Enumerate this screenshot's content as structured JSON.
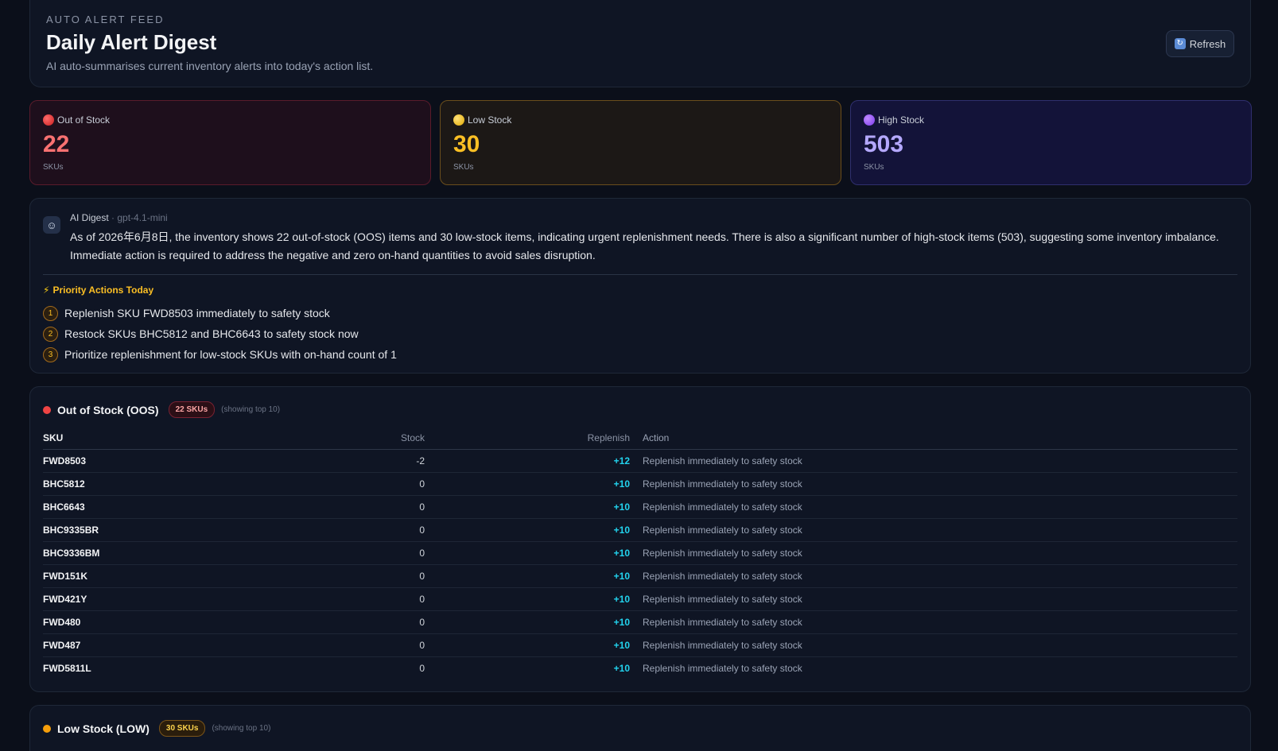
{
  "header": {
    "eyebrow": "AUTO ALERT FEED",
    "title": "Daily Alert Digest",
    "subtitle": "AI auto-summarises current inventory alerts into today's action list.",
    "refresh_label": "Refresh"
  },
  "stats": [
    {
      "label": "Out of Stock",
      "value": "22",
      "unit": "SKUs",
      "color": "#f87171"
    },
    {
      "label": "Low Stock",
      "value": "30",
      "unit": "SKUs",
      "color": "#fbbf24"
    },
    {
      "label": "High Stock",
      "value": "503",
      "unit": "SKUs",
      "color": "#b4a8ff"
    }
  ],
  "digest": {
    "label": "AI Digest",
    "model": "· gpt-4.1-mini",
    "text": "As of 2026年6月8日, the inventory shows 22 out-of-stock (OOS) items and 30 low-stock items, indicating urgent replenishment needs. There is also a significant number of high-stock items (503), suggesting some inventory imbalance. Immediate action is required to address the negative and zero on-hand quantities to avoid sales disruption.",
    "priority_title": "Priority Actions Today",
    "actions": [
      {
        "num": "1",
        "text": "Replenish SKU FWD8503 immediately to safety stock"
      },
      {
        "num": "2",
        "text": "Restock SKUs BHC5812 and BHC6643 to safety stock now"
      },
      {
        "num": "3",
        "text": "Prioritize replenishment for low-stock SKUs with on-hand count of 1"
      }
    ]
  },
  "oos_section": {
    "title": "Out of Stock (OOS)",
    "badge": "22 SKUs",
    "showing": "(showing top 10)",
    "columns": {
      "sku": "SKU",
      "stock": "Stock",
      "replenish": "Replenish",
      "action": "Action"
    },
    "rows": [
      {
        "sku": "FWD8503",
        "stock": "-2",
        "replenish": "+12",
        "action": "Replenish immediately to safety stock"
      },
      {
        "sku": "BHC5812",
        "stock": "0",
        "replenish": "+10",
        "action": "Replenish immediately to safety stock"
      },
      {
        "sku": "BHC6643",
        "stock": "0",
        "replenish": "+10",
        "action": "Replenish immediately to safety stock"
      },
      {
        "sku": "BHC9335BR",
        "stock": "0",
        "replenish": "+10",
        "action": "Replenish immediately to safety stock"
      },
      {
        "sku": "BHC9336BM",
        "stock": "0",
        "replenish": "+10",
        "action": "Replenish immediately to safety stock"
      },
      {
        "sku": "FWD151K",
        "stock": "0",
        "replenish": "+10",
        "action": "Replenish immediately to safety stock"
      },
      {
        "sku": "FWD421Y",
        "stock": "0",
        "replenish": "+10",
        "action": "Replenish immediately to safety stock"
      },
      {
        "sku": "FWD480",
        "stock": "0",
        "replenish": "+10",
        "action": "Replenish immediately to safety stock"
      },
      {
        "sku": "FWD487",
        "stock": "0",
        "replenish": "+10",
        "action": "Replenish immediately to safety stock"
      },
      {
        "sku": "FWD5811L",
        "stock": "0",
        "replenish": "+10",
        "action": "Replenish immediately to safety stock"
      }
    ]
  },
  "low_section": {
    "title": "Low Stock (LOW)",
    "badge": "30 SKUs",
    "showing": "(showing top 10)"
  }
}
